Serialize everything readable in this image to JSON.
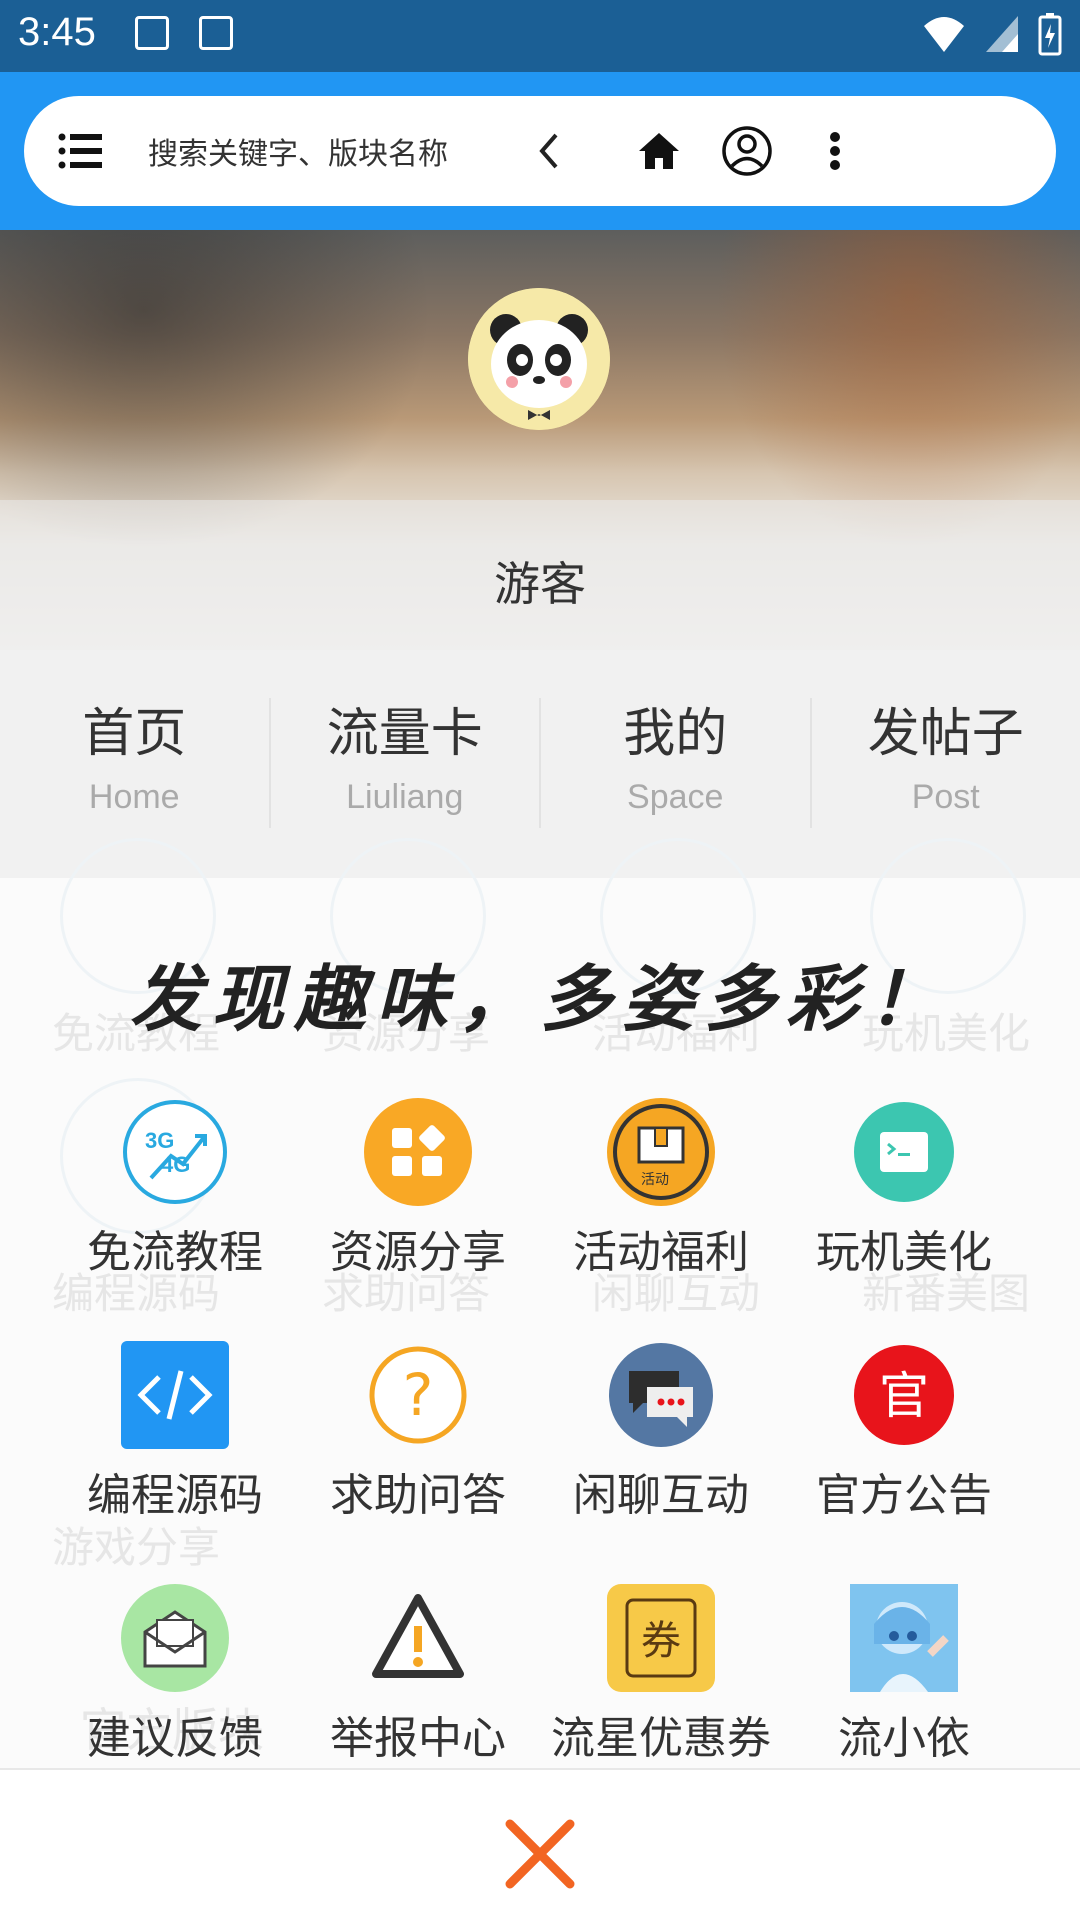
{
  "status_bar": {
    "time": "3:45"
  },
  "header": {
    "search_placeholder": "搜索关键字、版块名称",
    "icons": [
      "menu-icon",
      "back-icon",
      "home-icon",
      "user-icon",
      "more-icon"
    ]
  },
  "profile": {
    "username": "游客"
  },
  "nav": [
    {
      "title": "首页",
      "subtitle": "Home"
    },
    {
      "title": "流量卡",
      "subtitle": "Liuliang"
    },
    {
      "title": "我的",
      "subtitle": "Space"
    },
    {
      "title": "发帖子",
      "subtitle": "Post"
    }
  ],
  "popup": {
    "slogan": "发现趣味，多姿多彩！",
    "items": [
      {
        "label": "免流教程",
        "icon": "3g4g-icon",
        "color": "#29a9e0"
      },
      {
        "label": "资源分享",
        "icon": "grid-icon",
        "color": "#f9a825"
      },
      {
        "label": "活动福利",
        "icon": "gift-icon",
        "color": "#f5a623"
      },
      {
        "label": "玩机美化",
        "icon": "terminal-icon",
        "color": "#3cc6b0"
      },
      {
        "label": "编程源码",
        "icon": "code-icon",
        "color": "#2196f3"
      },
      {
        "label": "求助问答",
        "icon": "question-icon",
        "color": "#f5a623"
      },
      {
        "label": "闲聊互动",
        "icon": "chat-icon",
        "color": "#5477a3"
      },
      {
        "label": "官方公告",
        "icon": "official-icon",
        "color": "#e8141b",
        "glyph": "官"
      },
      {
        "label": "建议反馈",
        "icon": "mail-icon",
        "color": "#a8e6a3"
      },
      {
        "label": "举报中心",
        "icon": "warning-icon",
        "color": "#333333"
      },
      {
        "label": "流星优惠券",
        "icon": "coupon-icon",
        "color": "#f7c948",
        "glyph": "券"
      },
      {
        "label": "流小依",
        "icon": "anime-avatar-icon",
        "color": "#7fc4ef"
      }
    ],
    "background_labels": [
      "免流教程",
      "资源分享",
      "活动福利",
      "玩机美化",
      "编程源码",
      "求助问答",
      "闲聊互动",
      "新番美图",
      "游戏分享",
      "官方版块"
    ]
  },
  "colors": {
    "accent": "#2196f3",
    "status_bar": "#1b5f95",
    "close": "#f26522"
  }
}
